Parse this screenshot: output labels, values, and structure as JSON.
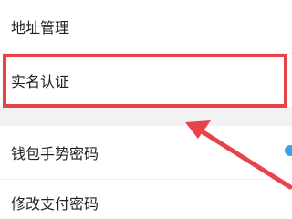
{
  "settings": {
    "items": [
      {
        "label": "地址管理"
      },
      {
        "label": "实名认证"
      },
      {
        "label": "钱包手势密码"
      },
      {
        "label": "修改支付密码"
      }
    ]
  },
  "annotation": {
    "highlight_color": "#e8434a",
    "highlighted_item": "实名认证"
  },
  "icons": {
    "pointer": "arrow-icon",
    "toggle": "toggle-switch-icon"
  }
}
